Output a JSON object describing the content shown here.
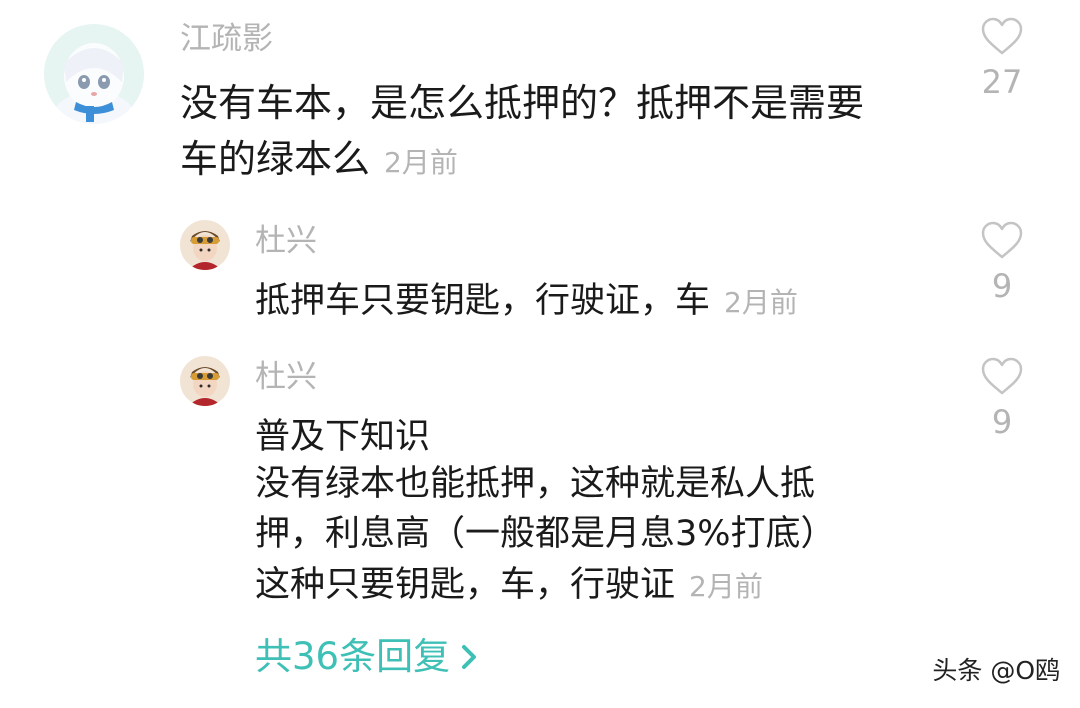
{
  "comment": {
    "username": "江疏影",
    "lines": [
      "没有车本，是怎么抵押的？抵押不是需要",
      "车的绿本么"
    ],
    "time": "2月前",
    "likes": "27"
  },
  "replies": [
    {
      "username": "杜兴",
      "lines": [
        "抵押车只要钥匙，行驶证，车"
      ],
      "time": "2月前",
      "likes": "9"
    },
    {
      "username": "杜兴",
      "lines": [
        "普及下知识",
        "没有绿本也能抵押，这种就是私人抵",
        "押，利息高（一般都是月息3%打底）",
        "这种只要钥匙，车，行驶证"
      ],
      "time": "2月前",
      "likes": "9"
    }
  ],
  "more_replies": "共36条回复",
  "watermark": "头条 @O鸥",
  "colors": {
    "accent": "#3fc0b6",
    "muted": "#b4b4b4",
    "text": "#1a1a1a"
  },
  "icons": {
    "like": "heart-outline-icon",
    "more": "chevron-right-icon"
  }
}
